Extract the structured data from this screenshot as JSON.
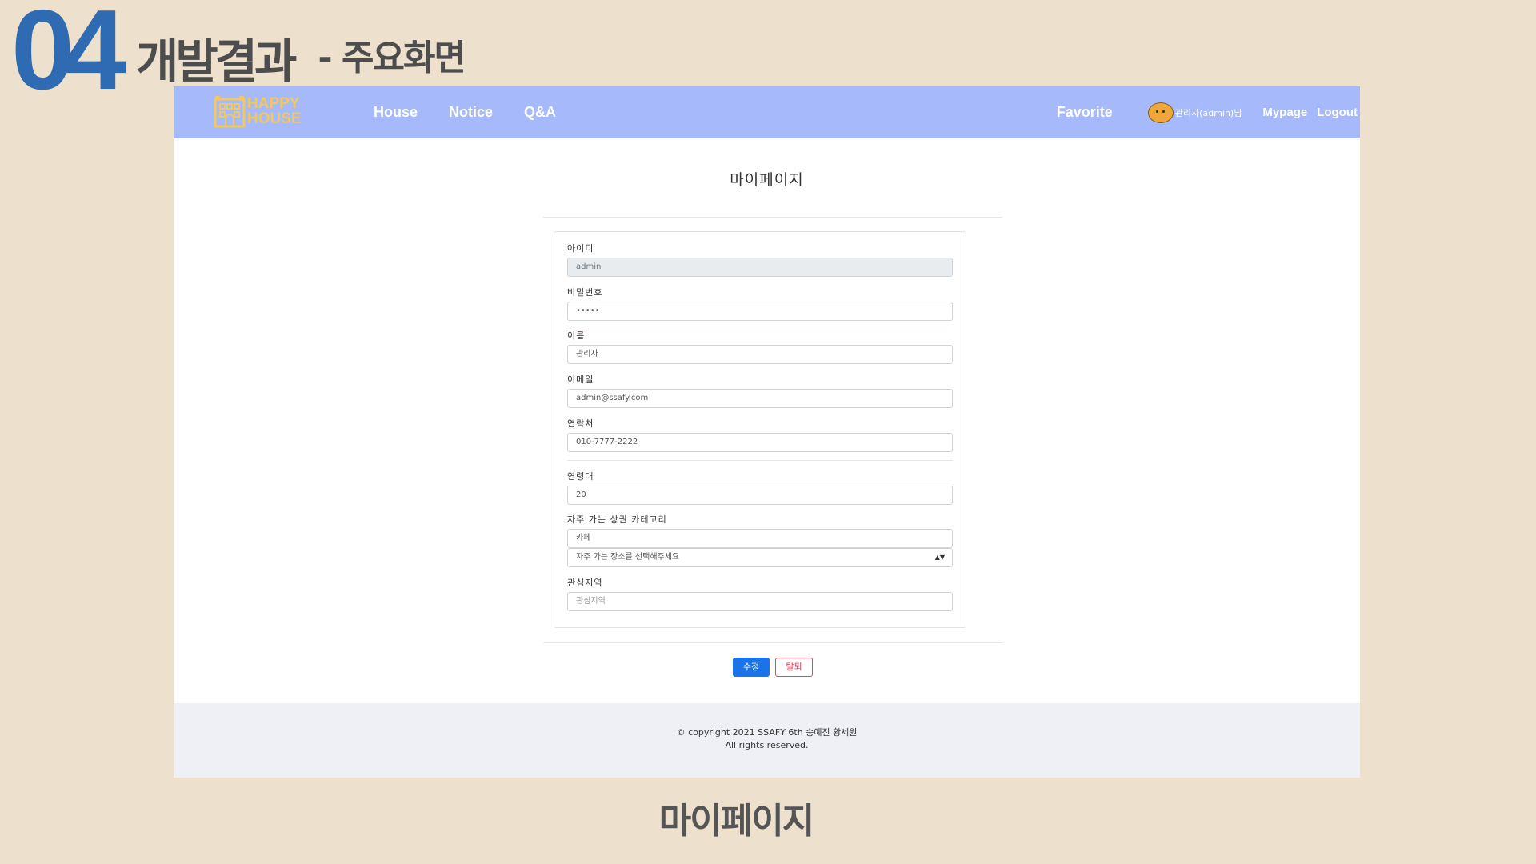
{
  "slide": {
    "number": "04",
    "title": "개발결과",
    "subtitle": "- 주요화면",
    "caption": "마이페이지"
  },
  "navbar": {
    "brand_line1": "HAPPY",
    "brand_line2": "HOUSE",
    "links": [
      "House",
      "Notice",
      "Q&A"
    ],
    "favorite": "Favorite",
    "user": "관리자(admin)님",
    "mypage": "Mypage",
    "logout": "Logout",
    "color": "#a6bafb"
  },
  "page": {
    "title": "마이페이지"
  },
  "form": {
    "id_label": "아이디",
    "id_value": "admin",
    "password_label": "비밀번호",
    "password_value": "•••••",
    "name_label": "이름",
    "name_value": "관리자",
    "email_label": "이메일",
    "email_value": "admin@ssafy.com",
    "phone_label": "연락처",
    "phone_value": "010-7777-2222",
    "age_label": "연령대",
    "age_value": "20",
    "category_label": "자주 가는 상권 카테고리",
    "category_value": "카페",
    "category_select": "자주 가는 장소를 선택해주세요",
    "interest_label": "관심지역",
    "interest_placeholder": "관심지역"
  },
  "buttons": {
    "edit": "수정",
    "leave": "탈퇴"
  },
  "footer": {
    "line1": "© copyright 2021 SSAFY 6th 송예진 황세원",
    "line2": "All rights reserved."
  }
}
